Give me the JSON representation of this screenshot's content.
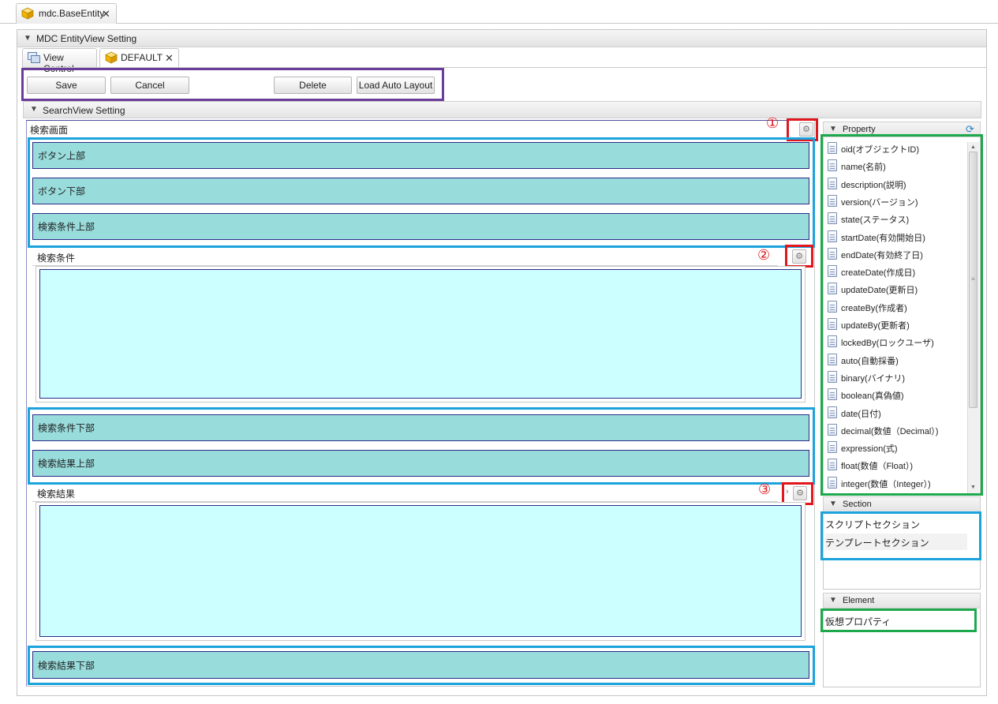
{
  "file_tab": {
    "title": "mdc.BaseEntity"
  },
  "panel": {
    "title": "MDC EntityView Setting"
  },
  "view_tabs": [
    {
      "label": "View Control"
    },
    {
      "label": "DEFAULT"
    }
  ],
  "toolbar": {
    "save": "Save",
    "cancel": "Cancel",
    "delete": "Delete",
    "load_auto_layout": "Load Auto Layout"
  },
  "search_view": {
    "title": "SearchView Setting",
    "screen_label": "検索画面",
    "top_sections": [
      "ボタン上部",
      "ボタン下部",
      "検索条件上部"
    ],
    "condition_label": "検索条件",
    "middle_sections": [
      "検索条件下部",
      "検索結果上部"
    ],
    "result_label": "検索結果",
    "bottom_section": "検索結果下部",
    "markers": [
      "①",
      "②",
      "③"
    ]
  },
  "property_panel": {
    "title": "Property",
    "items": [
      "oid(オブジェクトID)",
      "name(名前)",
      "description(説明)",
      "version(バージョン)",
      "state(ステータス)",
      "startDate(有効開始日)",
      "endDate(有効終了日)",
      "createDate(作成日)",
      "updateDate(更新日)",
      "createBy(作成者)",
      "updateBy(更新者)",
      "lockedBy(ロックユーザ)",
      "auto(自動採番)",
      "binary(バイナリ)",
      "boolean(真偽値)",
      "date(日付)",
      "decimal(数値（Decimal）)",
      "expression(式)",
      "float(数値（Float）)",
      "integer(数値（Integer）)"
    ]
  },
  "section_panel": {
    "title": "Section",
    "items": [
      "スクリプトセクション",
      "テンプレートセクション"
    ]
  },
  "element_panel": {
    "title": "Element",
    "items": [
      "仮想プロパティ"
    ]
  },
  "colors": {
    "highlight_red": "#e0171d",
    "highlight_blue": "#1ba3dc",
    "highlight_green": "#1ea84c",
    "highlight_purple": "#6a3d9a",
    "section_fill": "#98dcdc",
    "drop_area_fill": "#ccffff"
  }
}
